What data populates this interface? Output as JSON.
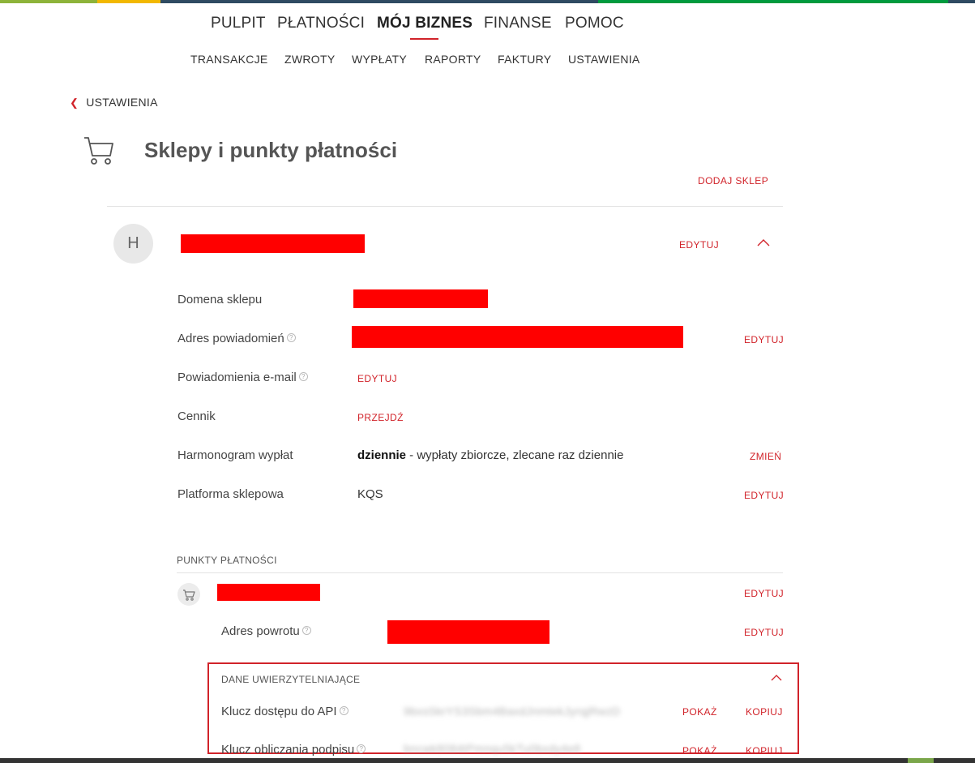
{
  "colors": {
    "accent": "#d1232a",
    "topbar": [
      "#8db33a",
      "#f2b800",
      "#2f4b62",
      "#009a3e"
    ]
  },
  "main_nav": [
    {
      "label": "PULPIT"
    },
    {
      "label": "PŁATNOŚCI"
    },
    {
      "label": "MÓJ BIZNES",
      "active": true
    },
    {
      "label": "FINANSE"
    },
    {
      "label": "POMOC"
    }
  ],
  "sub_nav": [
    {
      "label": "TRANSAKCJE"
    },
    {
      "label": "ZWROTY"
    },
    {
      "label": "WYPŁATY"
    },
    {
      "label": "RAPORTY"
    },
    {
      "label": "FAKTURY"
    },
    {
      "label": "USTAWIENIA"
    }
  ],
  "back_link": "USTAWIENIA",
  "page_title": "Sklepy i punkty płatności",
  "add_shop": "DODAJ SKLEP",
  "shop": {
    "avatar_letter": "H",
    "edit": "EDYTUJ",
    "rows": [
      {
        "label": "Domena sklepu",
        "help": false
      },
      {
        "label": "Adres powiadomień",
        "help": true,
        "action": "EDYTUJ"
      },
      {
        "label": "Powiadomienia e-mail",
        "help": true,
        "value_link": "EDYTUJ"
      },
      {
        "label": "Cennik",
        "help": false,
        "value_link": "PRZEJDŹ"
      },
      {
        "label": "Harmonogram wypłat",
        "help": false,
        "value_bold": "dziennie",
        "value_rest": " - wypłaty zbiorcze, zlecane raz dziennie",
        "action": "ZMIEŃ"
      },
      {
        "label": "Platforma sklepowa",
        "help": false,
        "value": "KQS",
        "action": "EDYTUJ"
      }
    ]
  },
  "payment_points": {
    "section_label": "PUNKTY PŁATNOŚCI",
    "edit": "EDYTUJ",
    "return_address": {
      "label": "Adres powrotu",
      "action": "EDYTUJ"
    },
    "credentials": {
      "title": "DANE UWIERZYTELNIAJĄCE",
      "rows": [
        {
          "label": "Klucz dostępu do API",
          "value": "9bxsSkrYS3Sbm4BaxdJnmtekJyrqjRwzD",
          "show": "POKAŻ",
          "copy": "KOPIUJ"
        },
        {
          "label": "Klucz obliczania podpisu",
          "value": "bncwk8084tPmnqu5kTu0bxdy4e8",
          "show": "POKAŻ",
          "copy": "KOPIUJ"
        }
      ]
    }
  }
}
